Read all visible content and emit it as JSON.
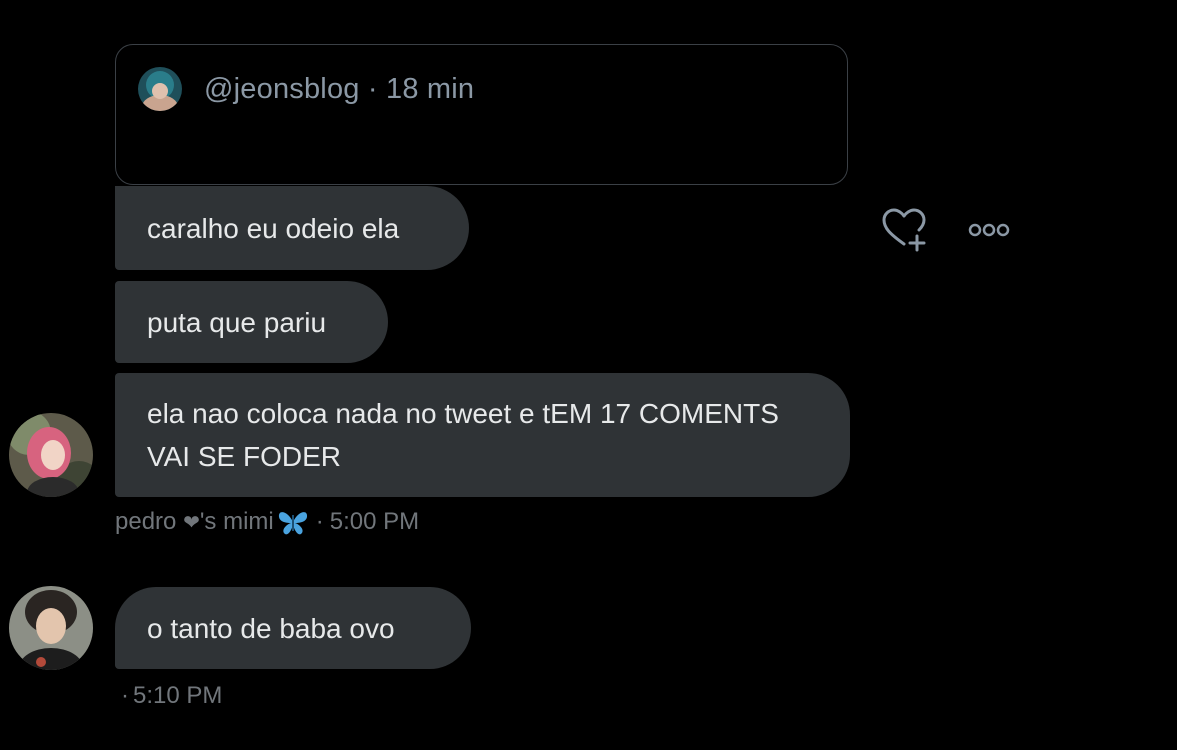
{
  "quote": {
    "handle": "@jeonsblog",
    "separator": "·",
    "time": "18 min"
  },
  "messages": [
    {
      "text": "caralho eu odeio ela"
    },
    {
      "text": "puta que pariu"
    },
    {
      "text": "ela nao coloca nada no tweet e tEM 17 COMENTS VAI SE FODER"
    },
    {
      "text": "o tanto de baba ovo"
    }
  ],
  "meta": [
    {
      "name_prefix": "pedro ",
      "heart": "❤",
      "name_suffix": "'s mimi",
      "separator": "·",
      "time": "5:00 PM"
    },
    {
      "name": "",
      "separator": "·",
      "time": "5:10 PM"
    }
  ],
  "icons": {
    "react": "heart-plus-icon",
    "more": "more-horizontal-icon",
    "butterfly": "butterfly-emoji-icon"
  },
  "colors": {
    "background": "#000000",
    "bubble": "#2f3336",
    "text": "#e7e9ea",
    "muted": "#71767b",
    "butterfly": "#4aa3df"
  }
}
